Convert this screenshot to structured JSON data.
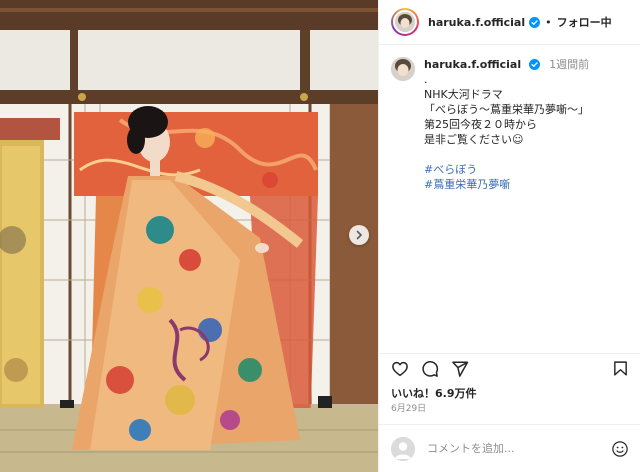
{
  "header": {
    "username": "haruka.f.official",
    "separator": "•",
    "follow_label": "フォロー中"
  },
  "caption": {
    "username": "haruka.f.official",
    "time": "1週間前",
    "lines": [
      ".",
      "NHK大河ドラマ",
      "「べらぼう〜蔦重栄華乃夢噺〜」",
      "第25回今夜２０時から",
      "是非ご覧ください☺︎"
    ],
    "hashtags": [
      "#べらぼう",
      "#蔦重栄華乃夢噺"
    ]
  },
  "stats": {
    "likes": "いいね！6.9万件",
    "date": "6月29日"
  },
  "comment": {
    "placeholder": "コメントを追加..."
  },
  "icons": {
    "verified": "verified-badge-icon",
    "next": "chevron-right-icon",
    "like": "heart-icon",
    "comment": "comment-icon",
    "share": "paper-plane-icon",
    "save": "bookmark-icon",
    "emoji": "emoji-icon"
  },
  "colors": {
    "verified": "#0095f6",
    "link": "#3b6fb6",
    "muted": "#8e8e8e"
  }
}
